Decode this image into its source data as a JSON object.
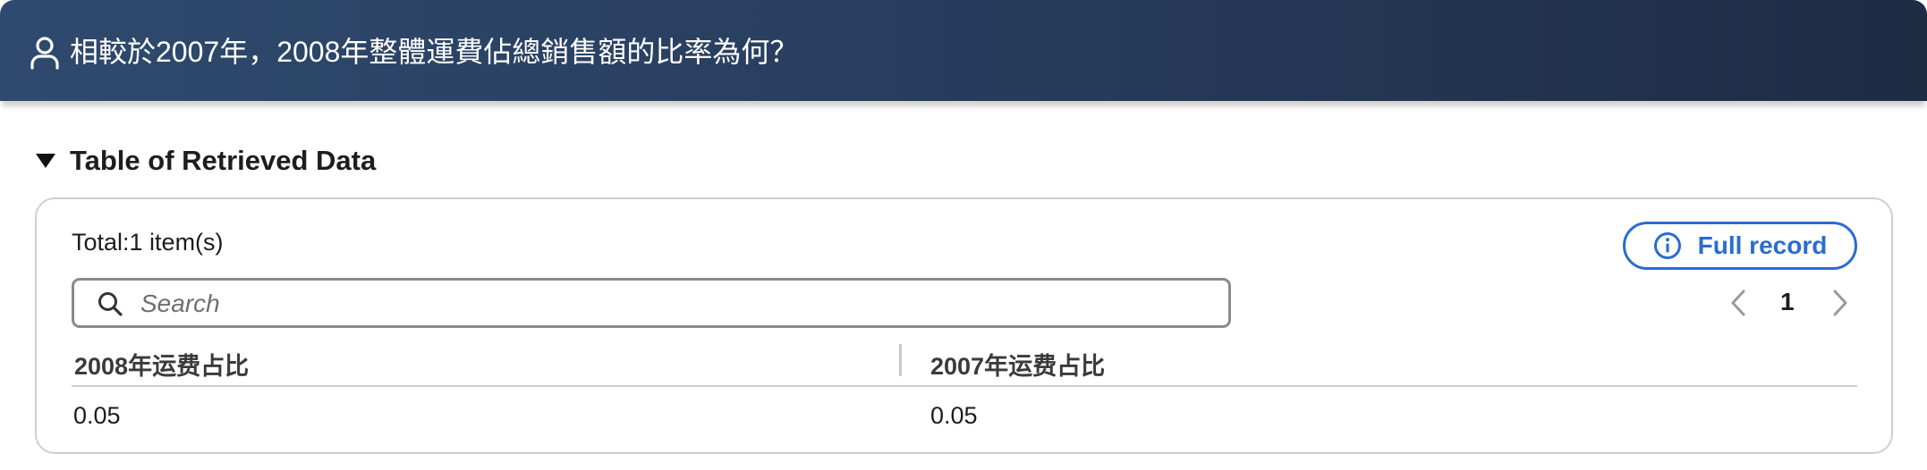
{
  "header": {
    "question": "相較於2007年，2008年整體運費佔總銷售額的比率為何？",
    "icon": "user-icon"
  },
  "section": {
    "title": "Table of Retrieved Data"
  },
  "table": {
    "total_label": "Total:1 item(s)",
    "full_record_label": "Full record",
    "search_placeholder": "Search",
    "search_value": "",
    "current_page": "1",
    "columns": [
      "2008年运费占比",
      "2007年运费占比"
    ],
    "rows": [
      [
        "0.05",
        "0.05"
      ]
    ]
  },
  "colors": {
    "header_bg": "#263b5a",
    "accent": "#2a6cd1"
  }
}
